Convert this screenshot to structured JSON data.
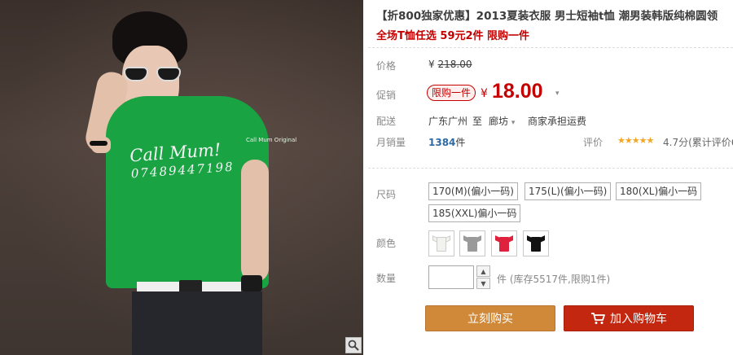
{
  "product": {
    "title": "【折800独家优惠】2013夏装衣服 男士短袖t恤 潮男装韩版纯棉圆领",
    "subtitle": "全场T恤任选 59元2件 限购一件"
  },
  "image": {
    "shirt_print_line1": "Call Mum!",
    "shirt_print_line2": "07489447198",
    "sleeve_tag": "Call Mum Original",
    "zoom_icon": "magnifier-icon"
  },
  "price": {
    "label": "价格",
    "currency": "¥",
    "original": "218.00"
  },
  "promo": {
    "label": "促销",
    "tag": "限购一件",
    "currency": "¥",
    "price": "18.00",
    "caret": "▾"
  },
  "delivery": {
    "label": "配送",
    "from": "广东广州",
    "to_word": "至",
    "to": "廊坊",
    "caret": "▾",
    "shipping": "商家承担运费"
  },
  "sales": {
    "label": "月销量",
    "count": "1384",
    "unit": "件",
    "rating_label": "评价",
    "stars": "★★★★★",
    "score": "4.7分(累计评价6"
  },
  "size": {
    "label": "尺码",
    "options": [
      "170(M)(偏小一码)",
      "175(L)(偏小一码)",
      "180(XL)偏小一码",
      "185(XXL)偏小一码"
    ]
  },
  "color": {
    "label": "颜色",
    "swatches": [
      {
        "name": "white",
        "hex": "#f2f2ee"
      },
      {
        "name": "grey",
        "hex": "#9a9a9a"
      },
      {
        "name": "red",
        "hex": "#e0213d"
      },
      {
        "name": "black",
        "hex": "#111111"
      }
    ]
  },
  "quantity": {
    "label": "数量",
    "value": "",
    "up": "▲",
    "down": "▼",
    "stock_text": "件 (库存5517件,限购1件)"
  },
  "actions": {
    "buy_now": "立刻购买",
    "add_to_cart": "加入购物车"
  },
  "colors": {
    "accent_red": "#c40000",
    "buy_orange": "#d08839",
    "cart_red": "#c4270f"
  }
}
